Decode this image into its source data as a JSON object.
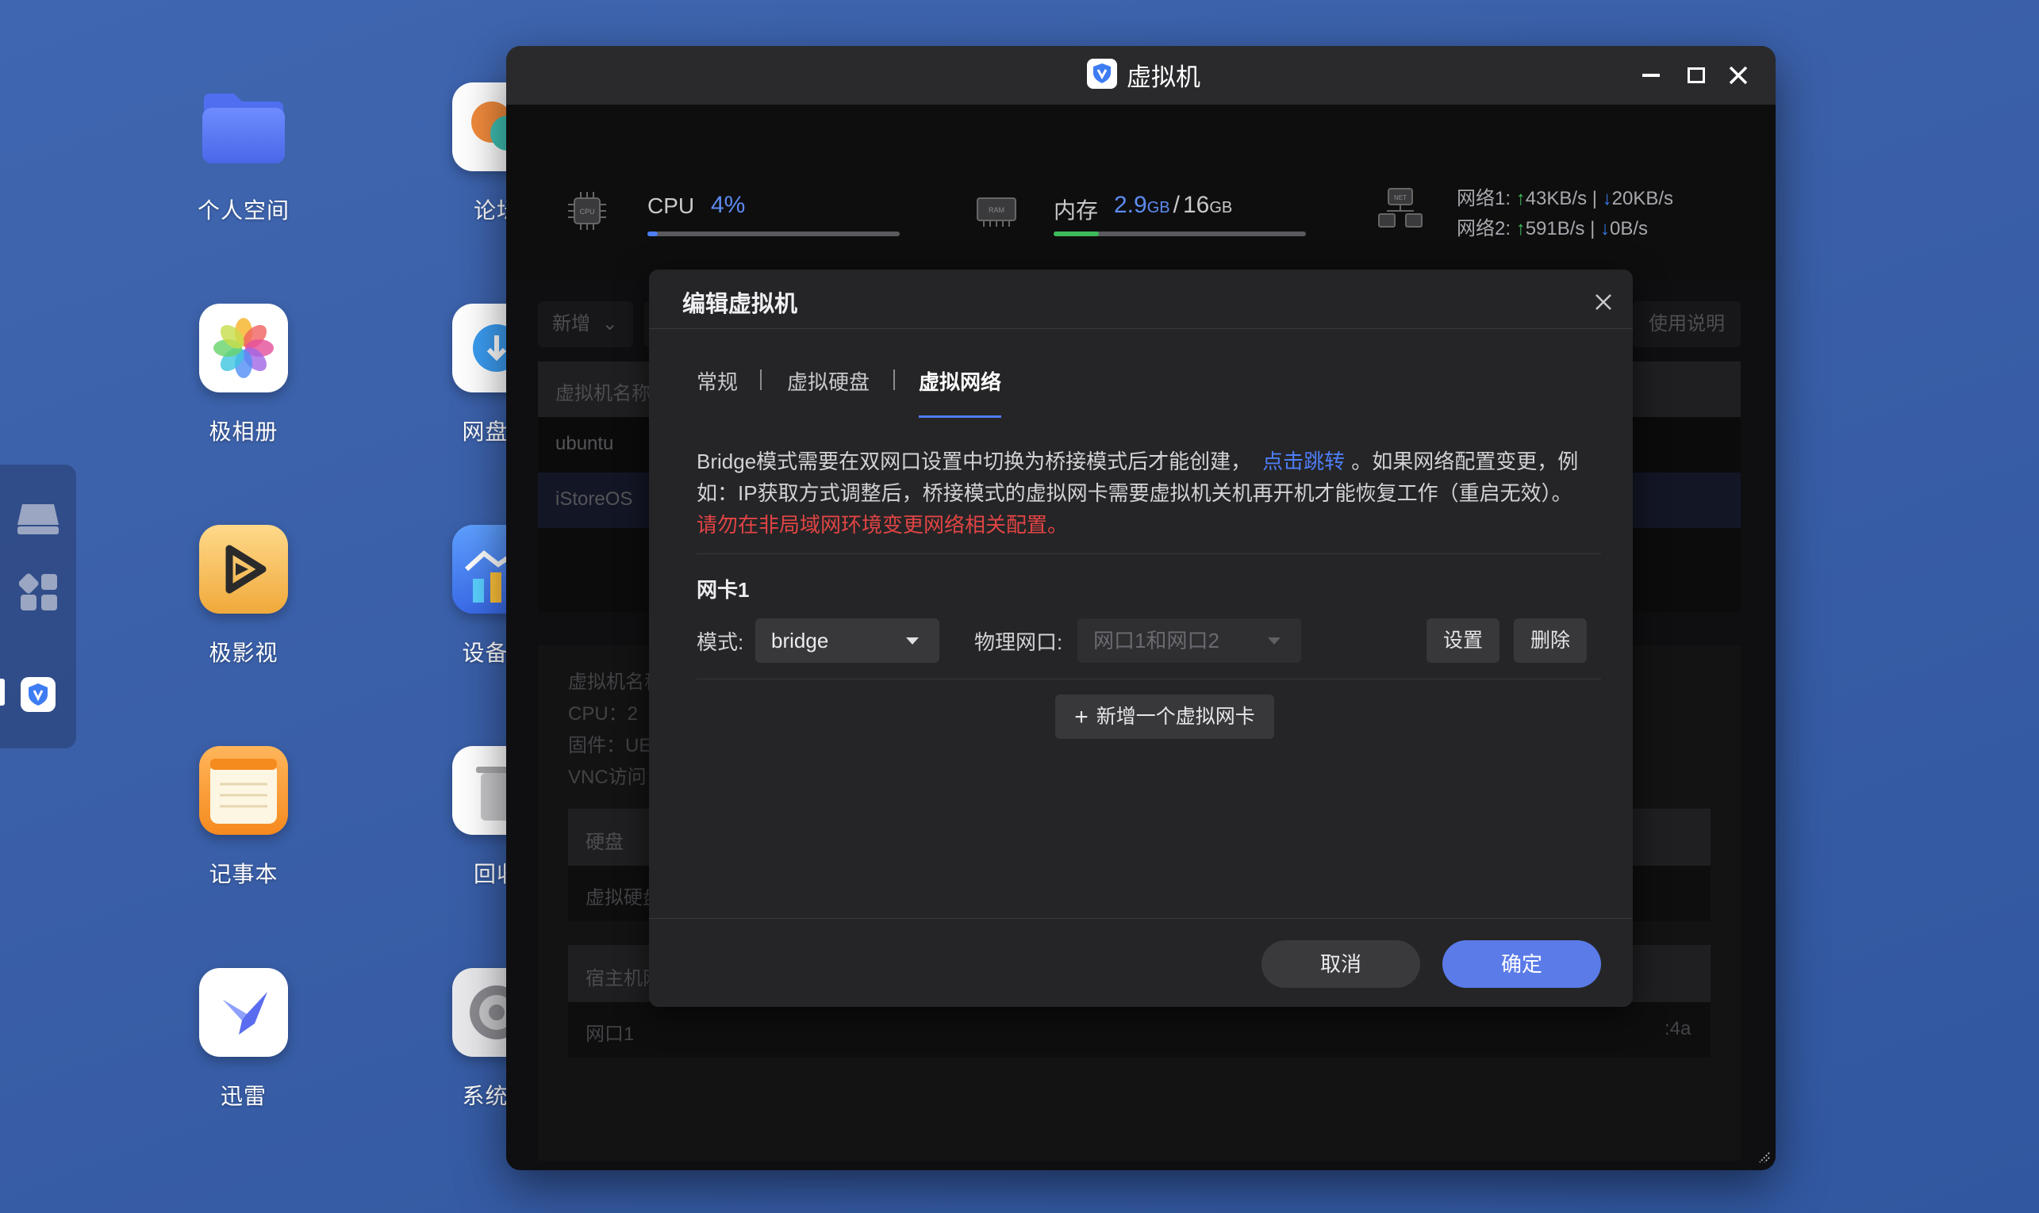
{
  "desktop": {
    "apps_left": [
      {
        "label": "个人空间"
      },
      {
        "label": "极相册"
      },
      {
        "label": "极影视"
      },
      {
        "label": "记事本"
      },
      {
        "label": "迅雷"
      }
    ],
    "apps_right": [
      {
        "label": "论坛"
      },
      {
        "label": "网盘备"
      },
      {
        "label": "设备监"
      },
      {
        "label": "回收"
      },
      {
        "label": "系统设"
      }
    ]
  },
  "window": {
    "title": "虚拟机",
    "stats": {
      "cpu_label": "CPU",
      "cpu_value": "4%",
      "cpu_fraction": 0.04,
      "cpu_chip_text": "CPU",
      "mem_label": "内存",
      "mem_used": "2.9",
      "mem_used_unit": "GB",
      "mem_slash": "/",
      "mem_total": "16",
      "mem_total_unit": "GB",
      "mem_fraction": 0.18,
      "ram_chip_text": "RAM",
      "net_chip_text": "NET",
      "net1_label": "网络1:",
      "net1_up": "43KB/s",
      "net1_down": "20KB/s",
      "net2_label": "网络2:",
      "net2_up": "591B/s",
      "net2_down": "0B/s",
      "sep": "|"
    },
    "toolbar": {
      "add_label": "新增",
      "help_label": "使用说明"
    },
    "vm_table": {
      "header": "虚拟机名称",
      "rows": [
        "ubuntu",
        "iStoreOS"
      ]
    },
    "details": {
      "name_label": "虚拟机名称",
      "cpu_line": "CPU：2",
      "firmware_line": "固件：UE",
      "vnc_line": "VNC访问",
      "disk_header": "硬盘",
      "disk_row": "虚拟硬盘",
      "host_header": "宿主机网",
      "host_row": "网口1",
      "mac_tail": ":4a"
    }
  },
  "modal": {
    "title": "编辑虚拟机",
    "tabs": [
      "常规",
      "虚拟硬盘",
      "虚拟网络"
    ],
    "active_tab": "虚拟网络",
    "info_text_1": "Bridge模式需要在双网口设置中切换为桥接模式后才能创建，",
    "info_link": "点击跳转",
    "info_text_2": "。如果网络配置变更，例如：IP获取方式调整后，桥接模式的虚拟网卡需要虚拟机关机再开机才能恢复工作（重启无效）。",
    "warning": "请勿在非局域网环境变更网络相关配置。",
    "nic_title": "网卡1",
    "mode_label": "模式:",
    "mode_value": "bridge",
    "phys_label": "物理网口:",
    "phys_value": "网口1和网口2",
    "settings_label": "设置",
    "delete_label": "删除",
    "add_nic_label": "新增一个虚拟网卡",
    "cancel_label": "取消",
    "confirm_label": "确定"
  }
}
